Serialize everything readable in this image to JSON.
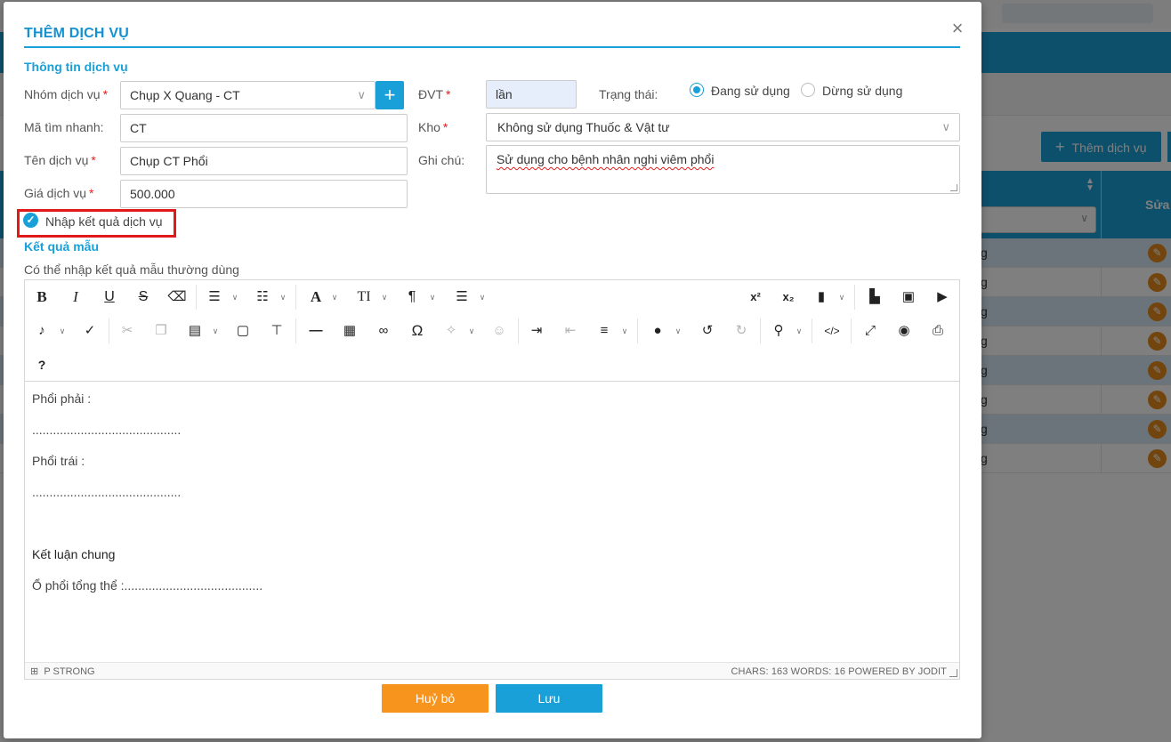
{
  "background": {
    "add_button_label": "Thêm dịch vụ",
    "edit_column_label": "Sửa",
    "row_text_fragment": "g"
  },
  "modal": {
    "title": "THÊM DỊCH VỤ",
    "close_symbol": "×"
  },
  "service_info": {
    "section_title": "Thông tin dịch vụ",
    "group_label": "Nhóm dịch vụ",
    "group_value": "Chụp X Quang - CT",
    "quick_code_label": "Mã tìm nhanh:",
    "quick_code_value": "CT",
    "name_label": "Tên dịch vụ",
    "name_value": "Chụp CT Phổi",
    "price_label": "Giá dịch vụ",
    "price_value": "500.000",
    "unit_label": "ĐVT",
    "unit_value": "lần",
    "status_label": "Trạng thái:",
    "status_options": [
      "Đang sử dụng",
      "Dừng sử dụng"
    ],
    "status_selected": "Đang sử dụng",
    "warehouse_label": "Kho",
    "warehouse_value": "Không sử dụng Thuốc & Vật tư",
    "note_label": "Ghi chú:",
    "note_value": "Sử dụng cho bệnh nhân nghi viêm phổi",
    "enter_result_label": "Nhập kết quả dịch vụ",
    "enter_result_checked": true,
    "required_mark": "*"
  },
  "sample_result": {
    "section_title": "Kết quả mẫu",
    "hint": "Có thể nhập kết quả mẫu thường dùng",
    "content": {
      "line1": "Phổi phải :",
      "line2": "...........................................",
      "line3": "Phổi trái :",
      "line4": "...........................................",
      "line5": "Kết luận chung",
      "line6": "Ổ phổi tổng thể :........................................"
    },
    "status_left": "P  STRONG",
    "status_right": "CHARS: 163   WORDS: 16   POWERED BY JODIT"
  },
  "toolbar": {
    "row1": [
      "bold-icon",
      "italic-icon",
      "underline-icon",
      "strikethrough-icon",
      "eraser-icon",
      "bullet-list-icon",
      "numbered-list-icon",
      "font-icon",
      "font-size-icon",
      "paragraph-icon",
      "line-height-icon",
      "superscript-icon",
      "subscript-icon",
      "file-icon",
      "image-icon",
      "video-icon"
    ],
    "row2": [
      "microphone-icon",
      "spellcheck-icon",
      "cut-icon",
      "copy-icon",
      "paste-icon",
      "select-all-icon",
      "format-painter-icon",
      "horizontal-rule-icon",
      "table-icon",
      "link-icon",
      "symbol-icon",
      "ai-magic-icon",
      "ai-assistant-icon",
      "indent-icon",
      "outdent-icon",
      "align-icon",
      "brush-icon",
      "undo-icon",
      "redo-icon",
      "find-icon",
      "source-icon",
      "fullscreen-icon",
      "preview-icon",
      "print-icon"
    ],
    "row3": [
      "help-icon"
    ],
    "help_glyph": "?",
    "bold_glyph": "B",
    "italic_glyph": "I",
    "underline_glyph": "U",
    "strike_glyph": "S",
    "font_glyph": "A",
    "fontsize_glyph": "TI",
    "paragraph_glyph": "¶",
    "sup_glyph": "x²",
    "sub_glyph": "x₂",
    "omega_glyph": "Ω",
    "source_glyph": "</>"
  },
  "buttons": {
    "cancel_label": "Huỷ bỏ",
    "save_label": "Lưu"
  },
  "colors": {
    "accent": "#1aa0d8",
    "cancel": "#f7941d",
    "highlight": "#e01a1a",
    "required": "#e02020"
  }
}
